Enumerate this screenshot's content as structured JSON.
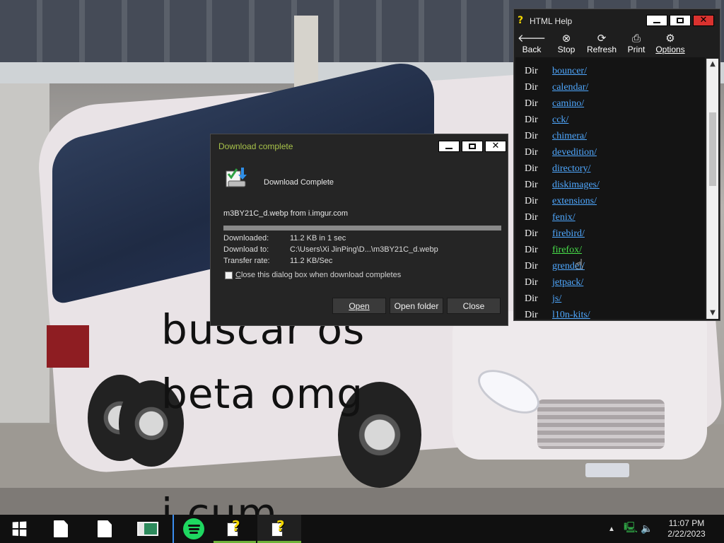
{
  "desktop": {
    "caption_lines": [
      "buscar os",
      "beta omg",
      "i cum"
    ]
  },
  "download_dialog": {
    "title": "Download complete",
    "heading": "Download Complete",
    "file_line": "m3BY21C_d.webp from i.imgur.com",
    "progress_percent": 100,
    "info": [
      {
        "label": "Downloaded:",
        "value": "11.2 KB in 1 sec"
      },
      {
        "label": "Download to:",
        "value": "C:\\Users\\Xi JinPing\\D...\\m3BY21C_d.webp"
      },
      {
        "label": "Transfer rate:",
        "value": "11.2 KB/Sec"
      }
    ],
    "close_checkbox": {
      "first_letter": "C",
      "rest": "lose this dialog box when download completes",
      "checked": false
    },
    "buttons": {
      "open": "Open",
      "open_folder": "Open folder",
      "close": "Close"
    },
    "accent_color": "#a8c34a"
  },
  "help_window": {
    "title": "HTML Help",
    "toolbar": [
      {
        "key": "back",
        "label": "Back",
        "icon": "back-arrow-icon"
      },
      {
        "key": "stop",
        "label": "Stop",
        "icon": "stop-icon"
      },
      {
        "key": "refresh",
        "label": "Refresh",
        "icon": "refresh-icon"
      },
      {
        "key": "print",
        "label": "Print",
        "icon": "print-icon"
      },
      {
        "key": "options",
        "label": "Options",
        "icon": "options-icon"
      }
    ],
    "entries": [
      {
        "type": "Dir",
        "name": "bouncer/"
      },
      {
        "type": "Dir",
        "name": "calendar/"
      },
      {
        "type": "Dir",
        "name": "camino/"
      },
      {
        "type": "Dir",
        "name": "cck/"
      },
      {
        "type": "Dir",
        "name": "chimera/"
      },
      {
        "type": "Dir",
        "name": "devedition/"
      },
      {
        "type": "Dir",
        "name": "directory/"
      },
      {
        "type": "Dir",
        "name": "diskimages/"
      },
      {
        "type": "Dir",
        "name": "extensions/"
      },
      {
        "type": "Dir",
        "name": "fenix/"
      },
      {
        "type": "Dir",
        "name": "firebird/"
      },
      {
        "type": "Dir",
        "name": "firefox/",
        "hovered": true
      },
      {
        "type": "Dir",
        "name": "grendel/"
      },
      {
        "type": "Dir",
        "name": "jetpack/"
      },
      {
        "type": "Dir",
        "name": "js/"
      },
      {
        "type": "Dir",
        "name": "l10n-kits/"
      }
    ],
    "link_color": "#4fa8ff",
    "hover_color": "#48e04a"
  },
  "taskbar": {
    "clock_time": "11:07 PM",
    "clock_date": "2/22/2023",
    "items": [
      "start-button",
      "document",
      "document",
      "app",
      "spotify",
      "html-help",
      "html-help"
    ]
  }
}
